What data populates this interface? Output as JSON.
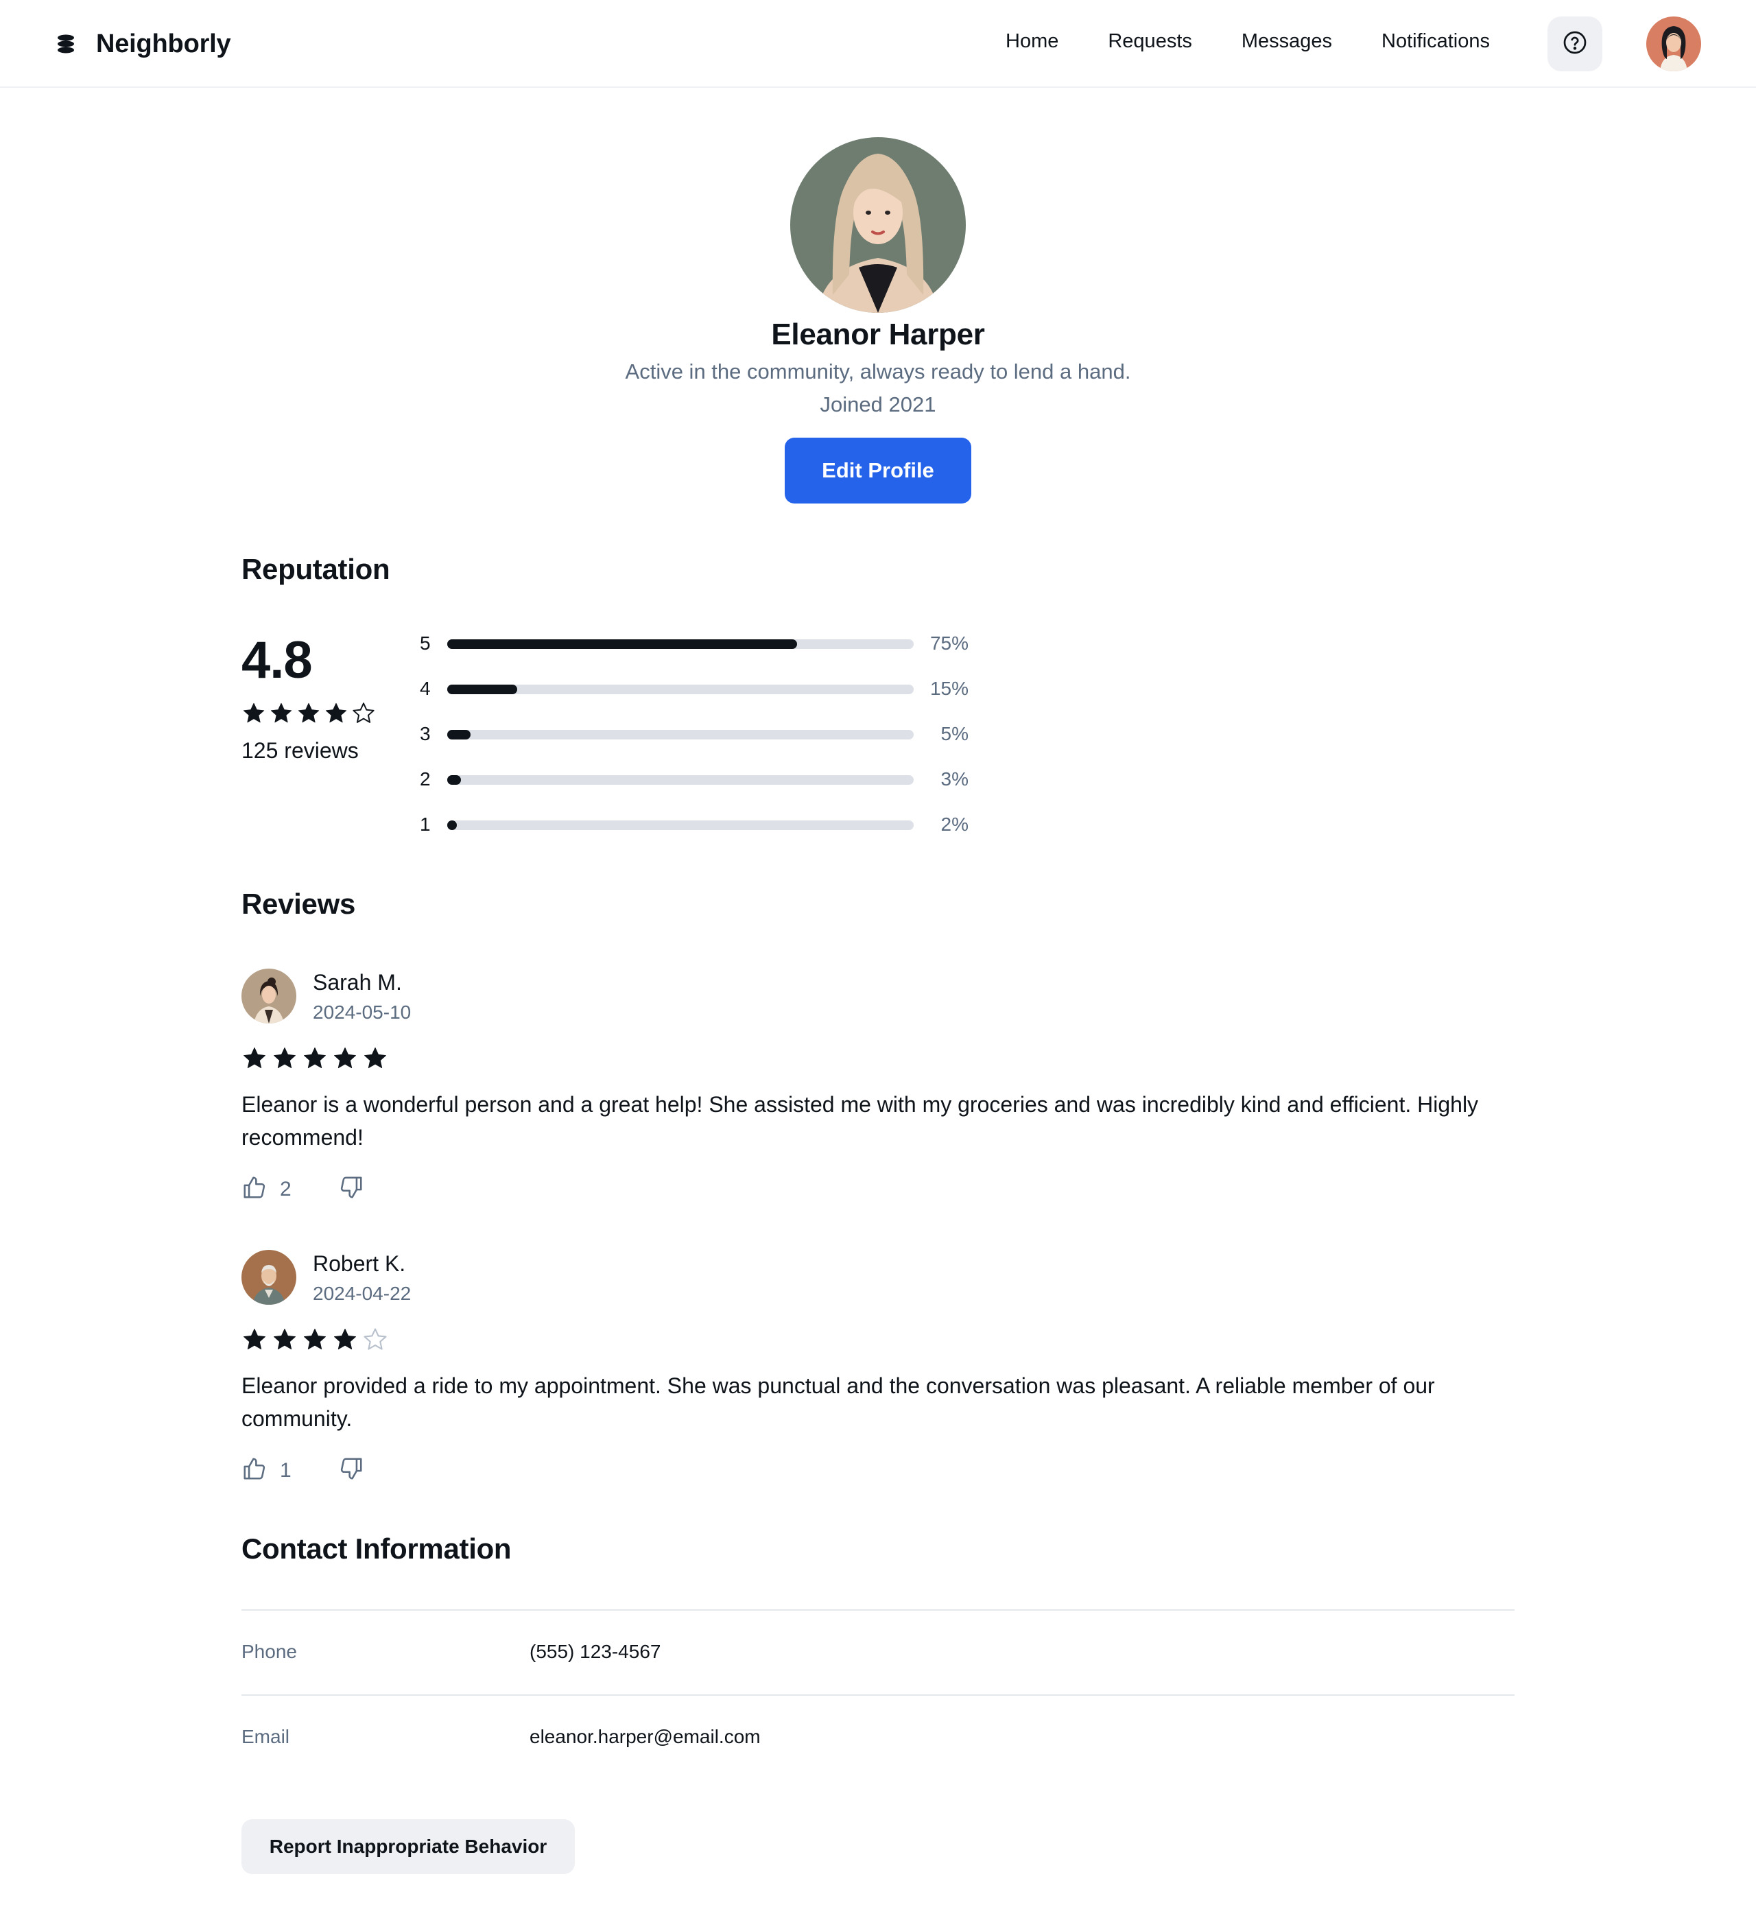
{
  "app": {
    "name": "Neighborly"
  },
  "nav": {
    "items": [
      "Home",
      "Requests",
      "Messages",
      "Notifications"
    ]
  },
  "header": {
    "help_icon": "help-circle-icon",
    "avatar": "user-avatar"
  },
  "profile": {
    "name": "Eleanor Harper",
    "bio": "Active in the community, always ready to lend a hand.",
    "joined": "Joined 2021",
    "edit_label": "Edit Profile"
  },
  "reputation": {
    "title": "Reputation",
    "rating": "4.8",
    "stars": 4,
    "max_stars": 5,
    "reviews_count": "125 reviews",
    "distribution": [
      {
        "label": "5",
        "percent": 75,
        "percent_label": "75%"
      },
      {
        "label": "4",
        "percent": 15,
        "percent_label": "15%"
      },
      {
        "label": "3",
        "percent": 5,
        "percent_label": "5%"
      },
      {
        "label": "2",
        "percent": 3,
        "percent_label": "3%"
      },
      {
        "label": "1",
        "percent": 2,
        "percent_label": "2%"
      }
    ]
  },
  "reviews": {
    "title": "Reviews",
    "items": [
      {
        "name": "Sarah M.",
        "date": "2024-05-10",
        "stars": 5,
        "text": "Eleanor is a wonderful person and a great help! She assisted me with my groceries and was incredibly kind and efficient. Highly recommend!",
        "likes": "2"
      },
      {
        "name": "Robert K.",
        "date": "2024-04-22",
        "stars": 4,
        "text": "Eleanor provided a ride to my appointment. She was punctual and the conversation was pleasant. A reliable member of our community.",
        "likes": "1"
      }
    ]
  },
  "contact": {
    "title": "Contact Information",
    "phone_label": "Phone",
    "phone": "(555) 123-4567",
    "email_label": "Email",
    "email": "eleanor.harper@email.com"
  },
  "report": {
    "label": "Report Inappropriate Behavior"
  },
  "colors": {
    "accent": "#2563eb",
    "text": "#0f141a",
    "muted": "#5b6b80",
    "track": "#dde1e7"
  }
}
